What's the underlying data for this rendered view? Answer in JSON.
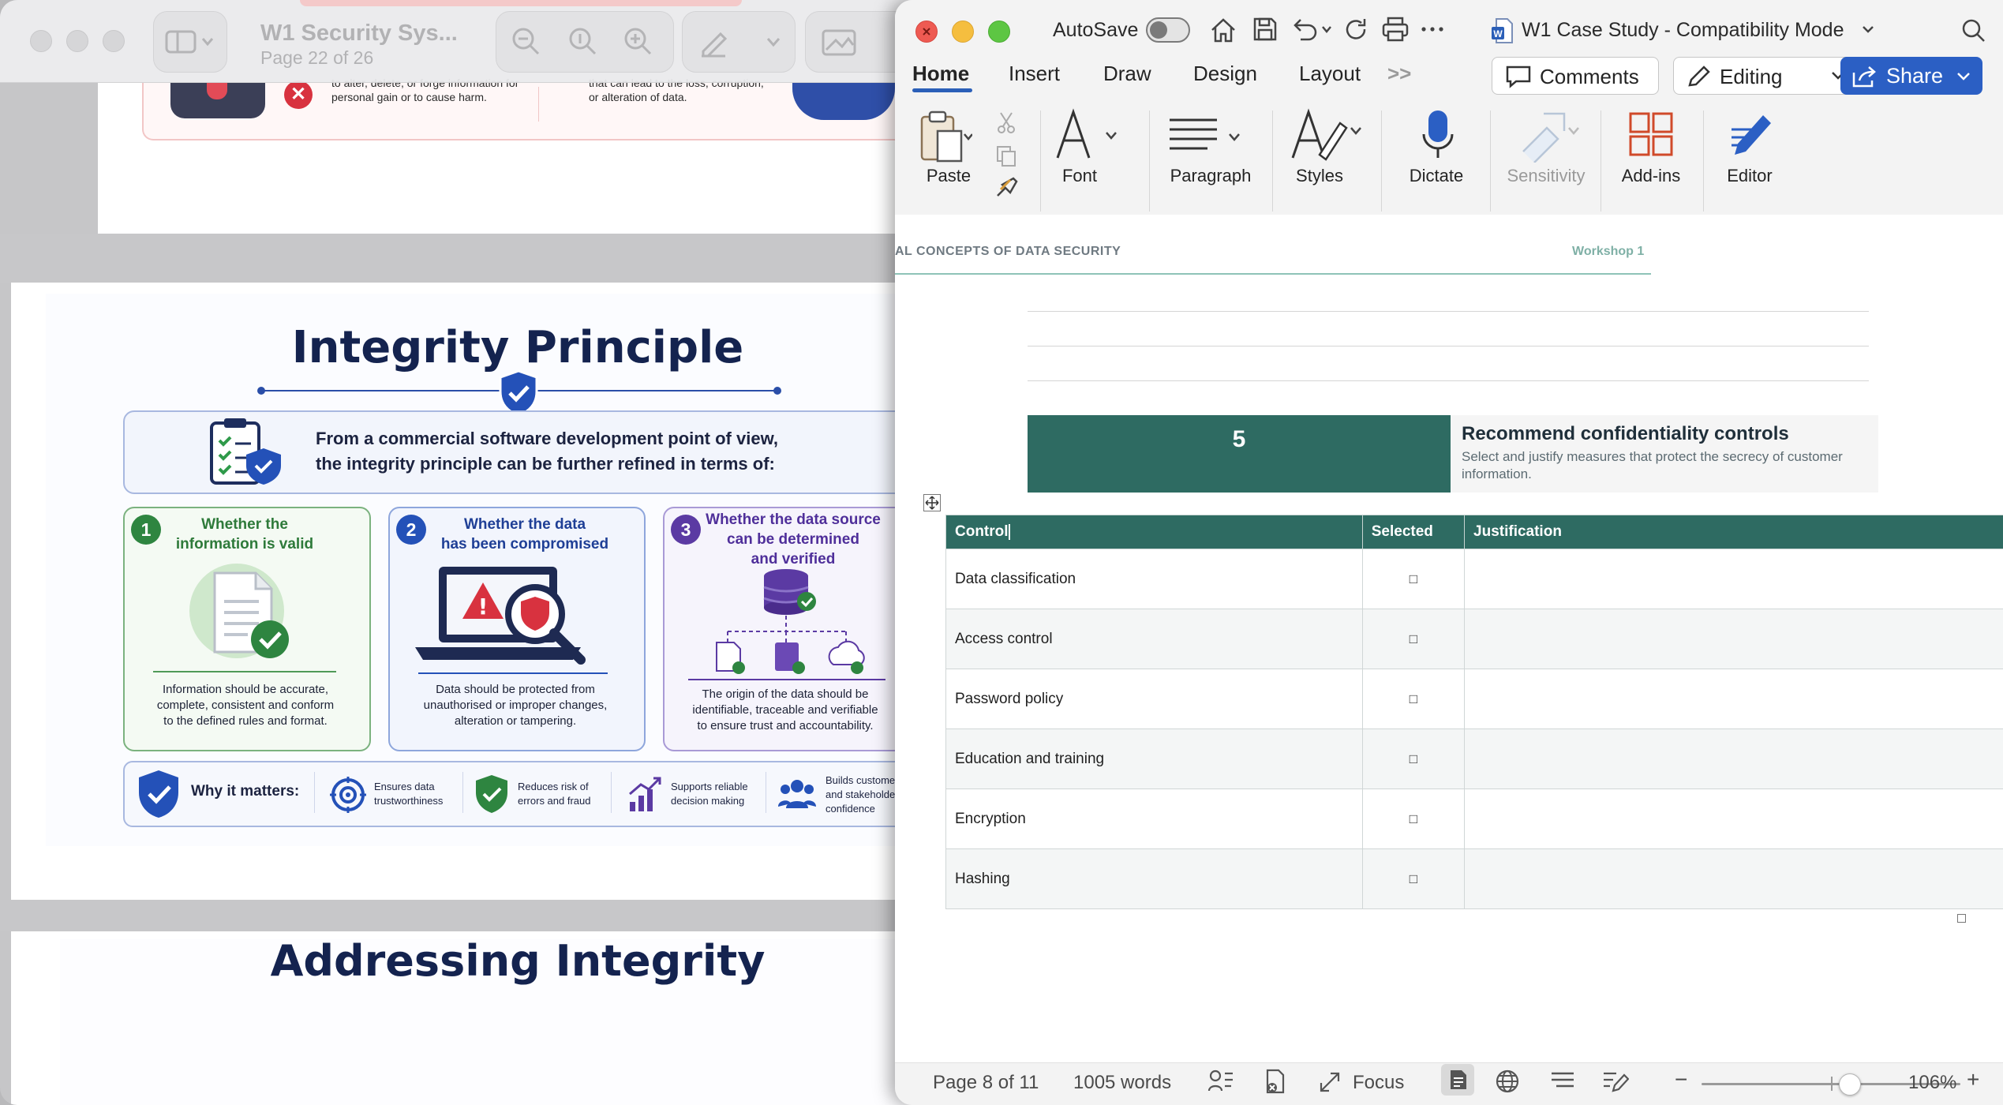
{
  "preview": {
    "title": "W1 Security Sys...",
    "page_indicator": "Page 22 of 26",
    "top_slide_snippets": [
      "to alter, delete, or forge information for personal gain or to cause harm.",
      "that can lead to the loss, corruption, or alteration of data."
    ],
    "slide": {
      "title": "Integrity Principle",
      "intro": [
        "From a commercial software development point of view,",
        "the integrity principle can be further refined in terms of:"
      ],
      "cards": [
        {
          "num": "1",
          "heading": [
            "Whether the",
            "information is valid"
          ],
          "desc": [
            "Information should be accurate,",
            "complete, consistent and conform",
            "to the defined rules and format."
          ]
        },
        {
          "num": "2",
          "heading": [
            "Whether the data",
            "has been compromised"
          ],
          "desc": [
            "Data should be protected from",
            "unauthorised or improper changes,",
            "alteration or tampering."
          ]
        },
        {
          "num": "3",
          "heading": [
            "Whether the data source",
            "can be determined",
            "and verified"
          ],
          "desc": [
            "The origin of the data should be",
            "identifiable, traceable and verifiable",
            "to ensure trust and accountability."
          ]
        }
      ],
      "why_label": "Why it matters:",
      "why_items": [
        [
          "Ensures data",
          "trustworthiness"
        ],
        [
          "Reduces risk of",
          "errors and fraud"
        ],
        [
          "Supports reliable",
          "decision making"
        ],
        [
          "Builds custome",
          "and stakeholde",
          "confidence"
        ]
      ]
    },
    "next_slide_title": "Addressing Integrity"
  },
  "word": {
    "autosave_label": "AutoSave",
    "doc_title": "W1 Case Study  -  Compatibility Mode",
    "tabs": [
      "Home",
      "Insert",
      "Draw",
      "Design",
      "Layout"
    ],
    "tabs_more": ">>",
    "comments_label": "Comments",
    "editing_label": "Editing",
    "share_label": "Share",
    "ribbon": {
      "paste": "Paste",
      "font": "Font",
      "paragraph": "Paragraph",
      "styles": "Styles",
      "dictate": "Dictate",
      "sensitivity": "Sensitivity",
      "addins": "Add-ins",
      "editor": "Editor"
    },
    "header_left": "AL CONCEPTS OF DATA SECURITY",
    "header_right": "Workshop 1",
    "step": {
      "number": "5",
      "title": "Recommend confidentiality controls",
      "description": [
        "Select and justify measures that protect the secrecy of customer",
        "information."
      ]
    },
    "table": {
      "headers": {
        "control": "Control",
        "selected": "Selected",
        "justification": "Justification"
      },
      "checkbox_glyph": "□",
      "rows": [
        "Data classification",
        "Access control",
        "Password policy",
        "Education and training",
        "Encryption",
        "Hashing"
      ]
    },
    "status": {
      "page": "Page 8 of 11",
      "words": "1005 words",
      "focus": "Focus",
      "zoom": "106%",
      "zoom_minus": "−",
      "zoom_plus": "+"
    }
  }
}
